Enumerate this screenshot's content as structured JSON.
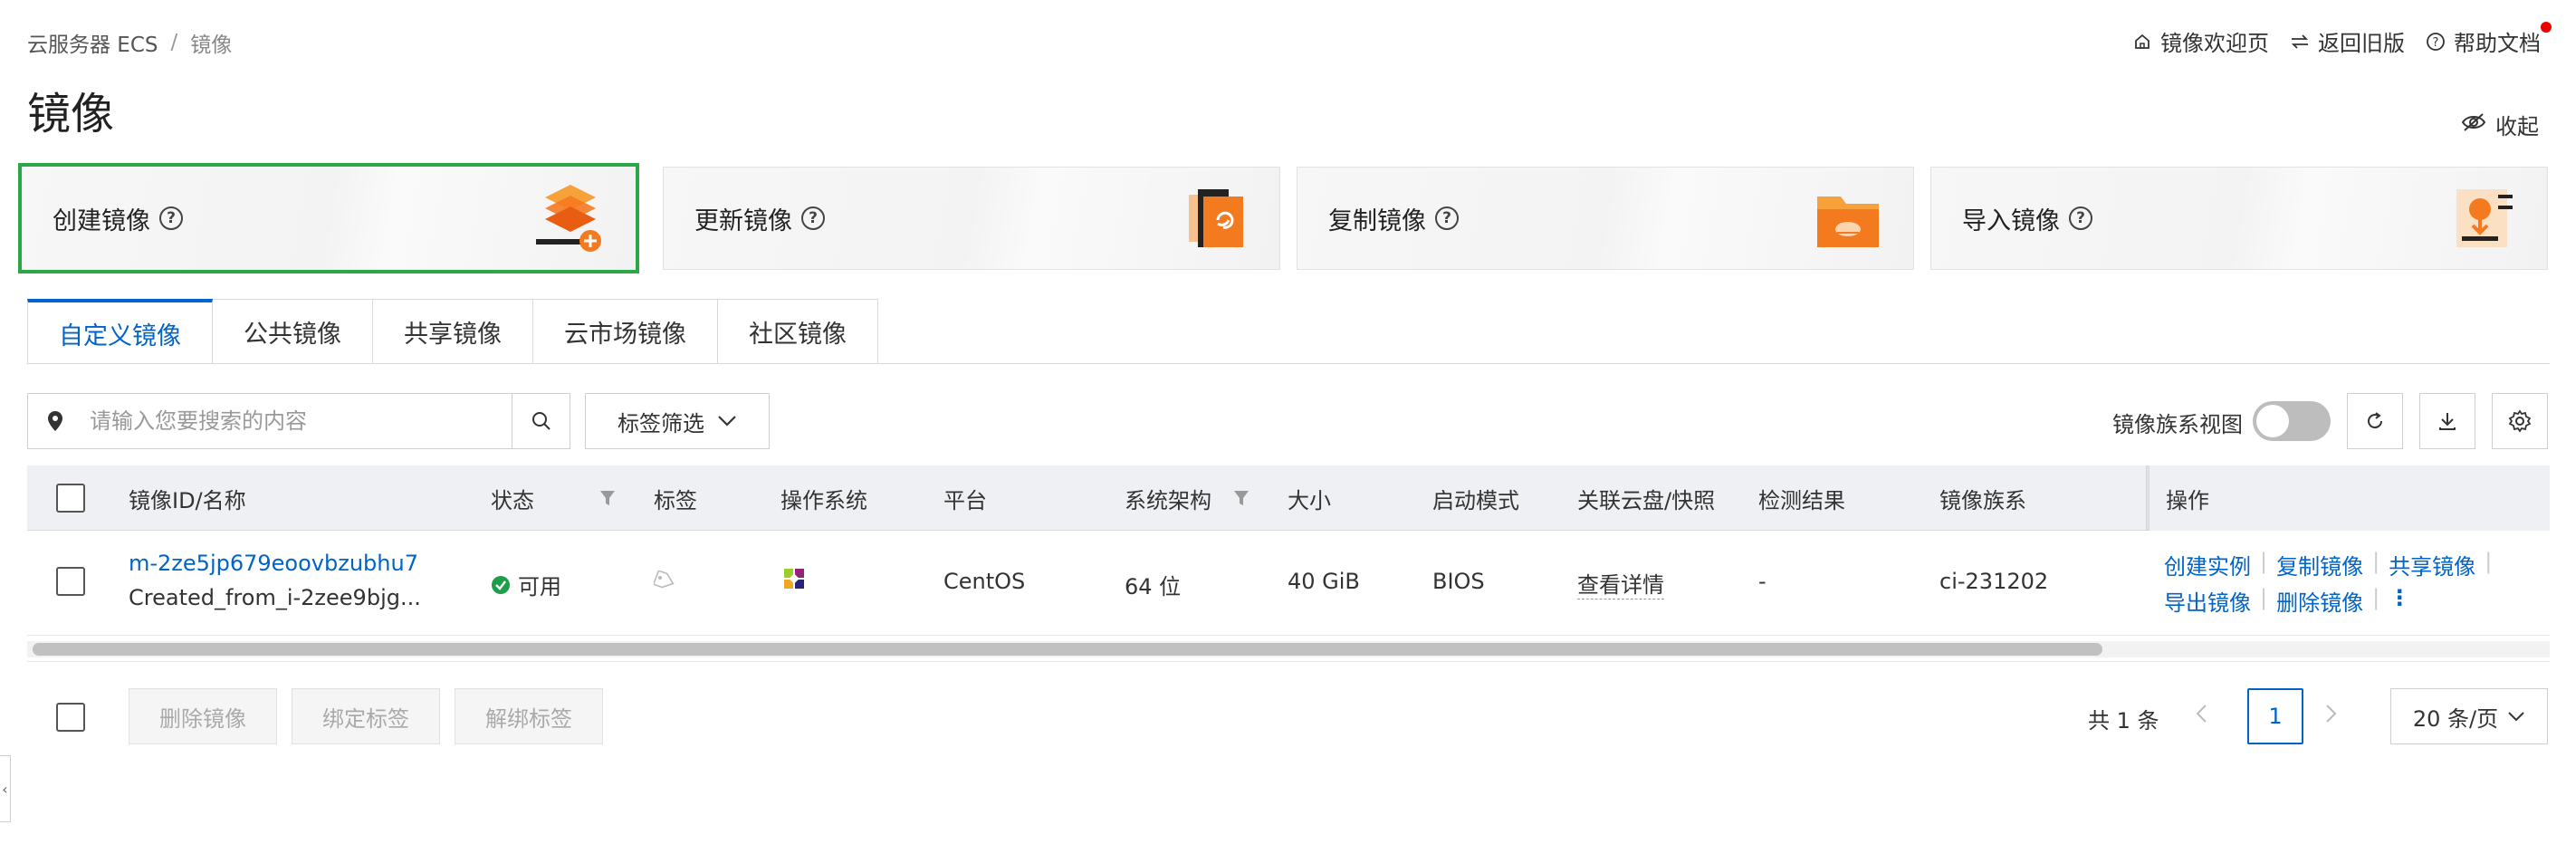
{
  "breadcrumb": {
    "root": "云服务器 ECS",
    "sep": "/",
    "current": "镜像"
  },
  "page_title": "镜像",
  "top_links": {
    "welcome": "镜像欢迎页",
    "old": "返回旧版",
    "help": "帮助文档"
  },
  "collapse_label": "收起",
  "cards": {
    "create": "创建镜像",
    "update": "更新镜像",
    "copy": "复制镜像",
    "import": "导入镜像"
  },
  "tabs": {
    "custom": "自定义镜像",
    "public": "公共镜像",
    "shared": "共享镜像",
    "market": "云市场镜像",
    "community": "社区镜像"
  },
  "search": {
    "placeholder": "请输入您要搜索的内容"
  },
  "tag_filter_label": "标签筛选",
  "family_view_label": "镜像族系视图",
  "columns": {
    "id": "镜像ID/名称",
    "status": "状态",
    "tags": "标签",
    "os": "操作系统",
    "platform": "平台",
    "arch": "系统架构",
    "size": "大小",
    "boot": "启动模式",
    "disk": "关联云盘/快照",
    "check": "检测结果",
    "family": "镜像族系",
    "ops": "操作"
  },
  "row": {
    "id": "m-2ze5jp679eoovbzubhu7",
    "name": "Created_from_i-2zee9bjg...",
    "status": "可用",
    "platform": "CentOS",
    "arch": "64 位",
    "size": "40 GiB",
    "boot": "BIOS",
    "disk": "查看详情",
    "check": "-",
    "family": "ci-231202",
    "ops": {
      "create": "创建实例",
      "copy": "复制镜像",
      "share": "共享镜像",
      "export": "导出镜像",
      "delete": "删除镜像",
      "more": "⋮"
    }
  },
  "footer": {
    "delete": "删除镜像",
    "bind": "绑定标签",
    "unbind": "解绑标签",
    "total": "共 1 条",
    "page": "1",
    "page_size": "20 条/页"
  },
  "colors": {
    "accent": "#0064c8",
    "selected_border": "#2aa848",
    "status_ok": "#1e9e4a",
    "orange": "#f47a20"
  },
  "icons": [
    "home-icon",
    "swap-icon",
    "help-icon",
    "eye-off-icon",
    "location-pin-icon",
    "search-icon",
    "chevron-down-icon",
    "refresh-icon",
    "download-icon",
    "gear-icon",
    "filter-icon",
    "tag-icon",
    "centos-icon",
    "check-circle-icon",
    "chevron-left-icon",
    "chevron-right-icon"
  ]
}
